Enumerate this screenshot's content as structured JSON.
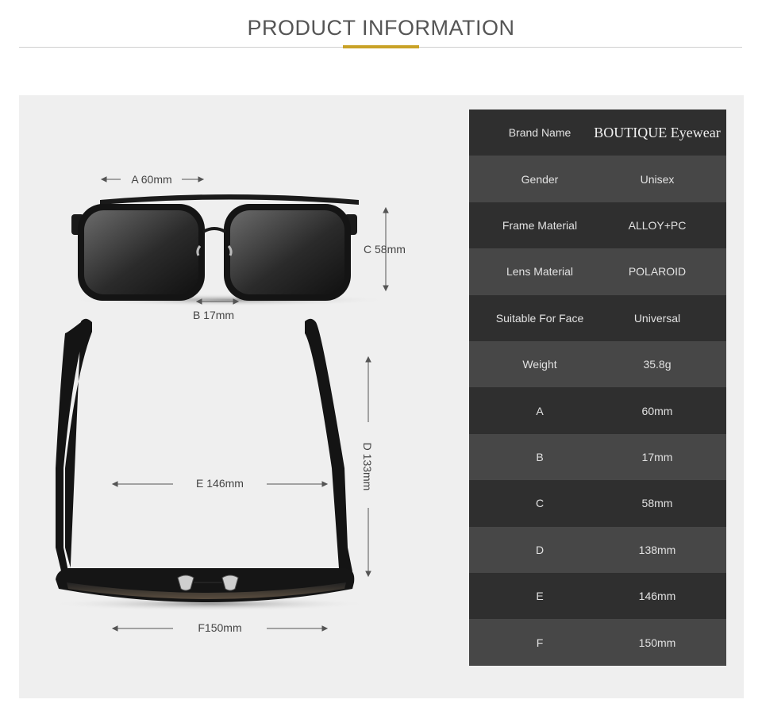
{
  "header": {
    "title": "PRODUCT INFORMATION"
  },
  "dimensions": {
    "a": "A 60mm",
    "b": "B 17mm",
    "c": "C 58mm",
    "d": "D 133mm",
    "e": "E 146mm",
    "f": "F150mm"
  },
  "specs": [
    {
      "key": "Brand Name",
      "value": "BOUTIQUE Eyewear"
    },
    {
      "key": "Gender",
      "value": "Unisex"
    },
    {
      "key": "Frame Material",
      "value": "ALLOY+PC"
    },
    {
      "key": "Lens Material",
      "value": "POLAROID"
    },
    {
      "key": "Suitable For Face",
      "value": "Universal"
    },
    {
      "key": "Weight",
      "value": "35.8g"
    },
    {
      "key": "A",
      "value": "60mm"
    },
    {
      "key": "B",
      "value": "17mm"
    },
    {
      "key": "C",
      "value": "58mm"
    },
    {
      "key": "D",
      "value": "138mm"
    },
    {
      "key": "E",
      "value": "146mm"
    },
    {
      "key": "F",
      "value": "150mm"
    }
  ],
  "colors": {
    "accent": "#c9a227",
    "panel": "#efefef",
    "row_dark": "#2f2f2f",
    "row_light": "#474747"
  }
}
